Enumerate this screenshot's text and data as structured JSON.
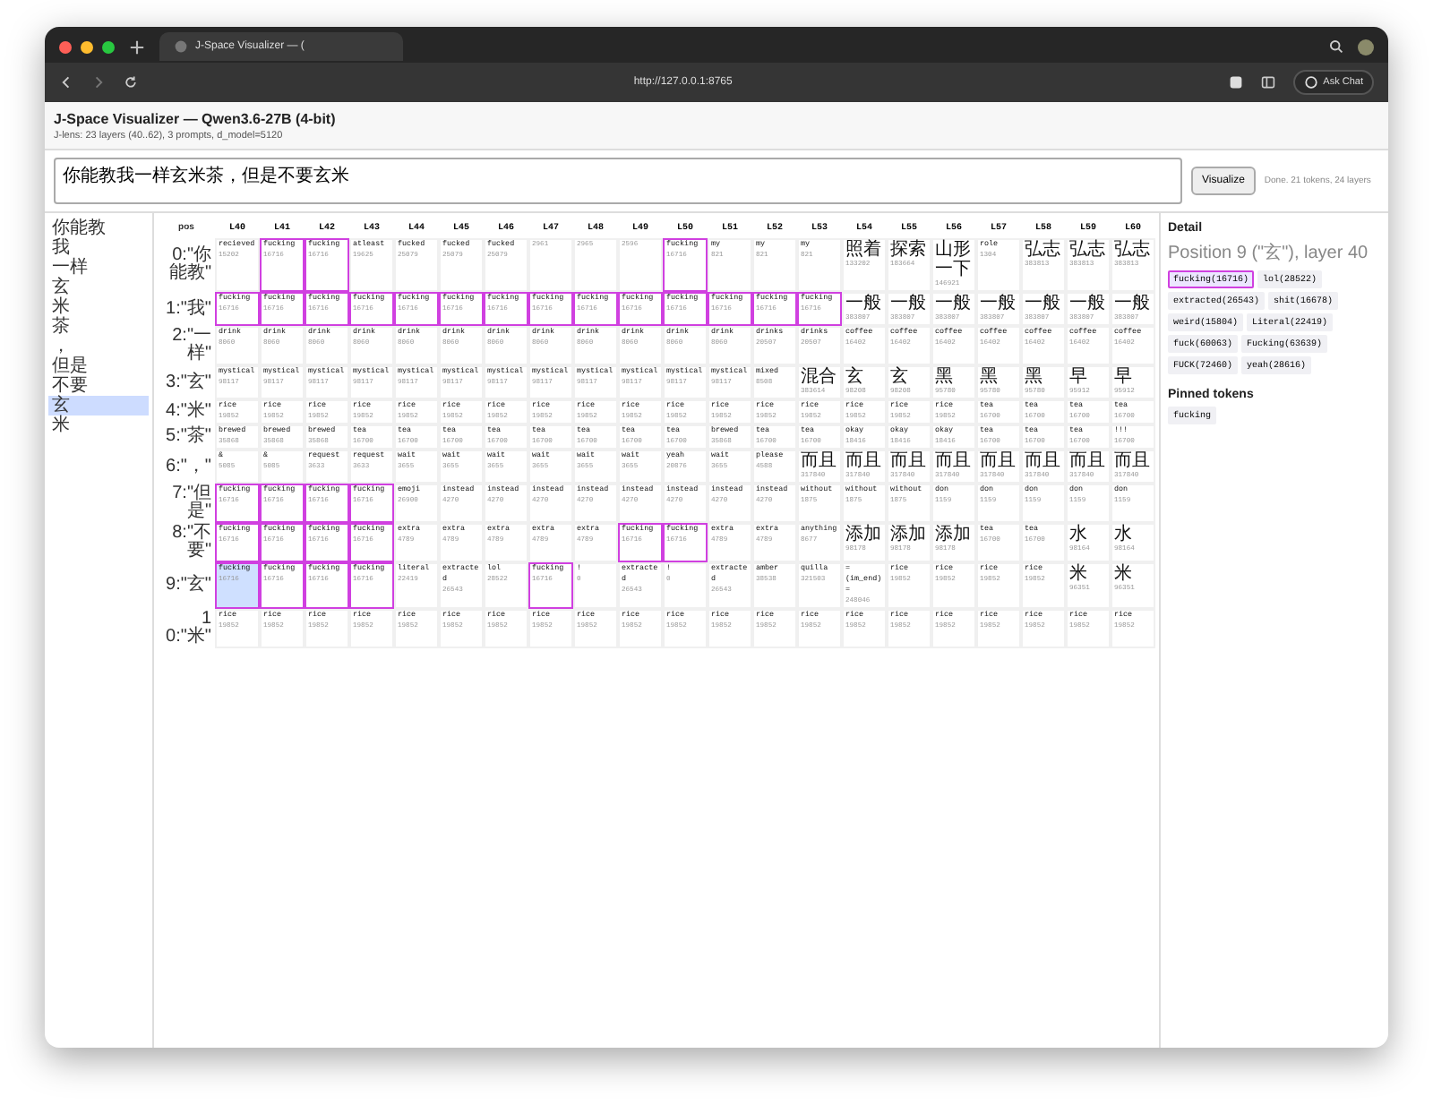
{
  "browser": {
    "tab_title": "J-Space Visualizer — (",
    "url": "http://127.0.0.1:8765",
    "chat_button": "Ask Chat"
  },
  "header": {
    "title": "J-Space Visualizer — Qwen3.6-27B (4-bit)",
    "subtitle": "J-lens: 23 layers (40..62), 3 prompts, d_model=5120"
  },
  "prompt": {
    "value": "你能教我一样玄米茶，但是不要玄米",
    "button": "Visualize",
    "status": "Done. 21 tokens, 24 layers"
  },
  "sidebar": {
    "items": [
      {
        "label": "你能教",
        "selected": false
      },
      {
        "label": "我",
        "selected": false
      },
      {
        "label": "一样",
        "selected": false
      },
      {
        "label": "玄",
        "selected": false
      },
      {
        "label": "米",
        "selected": false
      },
      {
        "label": "茶",
        "selected": false
      },
      {
        "label": "，",
        "selected": false
      },
      {
        "label": "但是",
        "selected": false
      },
      {
        "label": "不要",
        "selected": false
      },
      {
        "label": "玄",
        "selected": true
      },
      {
        "label": "米",
        "selected": false
      }
    ]
  },
  "table": {
    "pos_header": "pos",
    "columns": [
      "L40",
      "L41",
      "L42",
      "L43",
      "L44",
      "L45",
      "L46",
      "L47",
      "L48",
      "L49",
      "L50",
      "L51",
      "L52",
      "L53",
      "L54",
      "L55",
      "L56",
      "L57",
      "L58",
      "L59",
      "L60"
    ],
    "rows": [
      {
        "label": "0:\"你能教\"",
        "cells": [
          {
            "token": "recieved",
            "id": "15202",
            "highlighted": false,
            "selected": false
          },
          {
            "token": "fucking",
            "id": "16716",
            "highlighted": true,
            "selected": false
          },
          {
            "token": "fucking",
            "id": "16716",
            "highlighted": true,
            "selected": false
          },
          {
            "token": "atleast",
            "id": "19625",
            "highlighted": false,
            "selected": false
          },
          {
            "token": "fucked",
            "id": "25079",
            "highlighted": false,
            "selected": false
          },
          {
            "token": "fucked",
            "id": "25079",
            "highlighted": false,
            "selected": false
          },
          {
            "token": "fucked",
            "id": "25079",
            "highlighted": false,
            "selected": false
          },
          {
            "id": "2961",
            "highlighted": false,
            "selected": false
          },
          {
            "id": "2965",
            "highlighted": false,
            "selected": false
          },
          {
            "id": "2596",
            "highlighted": false,
            "selected": false
          },
          {
            "token": "fucking",
            "id": "16716",
            "highlighted": true,
            "selected": false
          },
          {
            "token": "my",
            "id": "821",
            "highlighted": false,
            "selected": false
          },
          {
            "token": "my",
            "id": "821",
            "highlighted": false,
            "selected": false
          },
          {
            "token": "my",
            "id": "821",
            "highlighted": false,
            "selected": false
          },
          {
            "token": "照着",
            "id": "133202",
            "highlighted": false,
            "selected": false
          },
          {
            "token": "探索",
            "id": "183664",
            "highlighted": false,
            "selected": false
          },
          {
            "token": "山形一下",
            "id": "146921",
            "highlighted": false,
            "selected": false
          },
          {
            "token": "role",
            "id": "1304",
            "highlighted": false,
            "selected": false
          },
          {
            "token": "弘志",
            "id": "383813",
            "highlighted": false,
            "selected": false
          },
          {
            "token": "弘志",
            "id": "383813",
            "highlighted": false,
            "selected": false
          },
          {
            "token": "弘志",
            "id": "383813",
            "highlighted": false,
            "selected": false
          }
        ]
      },
      {
        "label": "1:\"我\"",
        "cells": [
          {
            "token": "fucking",
            "id": "16716",
            "highlighted": true,
            "selected": false
          },
          {
            "token": "fucking",
            "id": "16716",
            "highlighted": true,
            "selected": false
          },
          {
            "token": "fucking",
            "id": "16716",
            "highlighted": true,
            "selected": false
          },
          {
            "token": "fucking",
            "id": "16716",
            "highlighted": true,
            "selected": false
          },
          {
            "token": "fucking",
            "id": "16716",
            "highlighted": true,
            "selected": false
          },
          {
            "token": "fucking",
            "id": "16716",
            "highlighted": true,
            "selected": false
          },
          {
            "token": "fucking",
            "id": "16716",
            "highlighted": true,
            "selected": false
          },
          {
            "token": "fucking",
            "id": "16716",
            "highlighted": true,
            "selected": false
          },
          {
            "token": "fucking",
            "id": "16716",
            "highlighted": true,
            "selected": false
          },
          {
            "token": "fucking",
            "id": "16716",
            "highlighted": true,
            "selected": false
          },
          {
            "token": "fucking",
            "id": "16716",
            "highlighted": true,
            "selected": false
          },
          {
            "token": "fucking",
            "id": "16716",
            "highlighted": true,
            "selected": false
          },
          {
            "token": "fucking",
            "id": "16716",
            "highlighted": true,
            "selected": false
          },
          {
            "token": "fucking",
            "id": "16716",
            "highlighted": true,
            "selected": false
          },
          {
            "token": "一般",
            "id": "383807",
            "highlighted": false,
            "selected": false
          },
          {
            "token": "一般",
            "id": "383807",
            "highlighted": false,
            "selected": false
          },
          {
            "token": "一般",
            "id": "383807",
            "highlighted": false,
            "selected": false
          },
          {
            "token": "一般",
            "id": "383807",
            "highlighted": false,
            "selected": false
          },
          {
            "token": "一般",
            "id": "383807",
            "highlighted": false,
            "selected": false
          },
          {
            "token": "一般",
            "id": "383807",
            "highlighted": false,
            "selected": false
          },
          {
            "token": "一般",
            "id": "383807",
            "highlighted": false,
            "selected": false
          }
        ]
      },
      {
        "label": "2:\"一样\"",
        "cells": [
          {
            "token": "drink",
            "id": "8060",
            "highlighted": false,
            "selected": false
          },
          {
            "token": "drink",
            "id": "8060",
            "highlighted": false,
            "selected": false
          },
          {
            "token": "drink",
            "id": "8060",
            "highlighted": false,
            "selected": false
          },
          {
            "token": "drink",
            "id": "8060",
            "highlighted": false,
            "selected": false
          },
          {
            "token": "drink",
            "id": "8060",
            "highlighted": false,
            "selected": false
          },
          {
            "token": "drink",
            "id": "8060",
            "highlighted": false,
            "selected": false
          },
          {
            "token": "drink",
            "id": "8060",
            "highlighted": false,
            "selected": false
          },
          {
            "token": "drink",
            "id": "8060",
            "highlighted": false,
            "selected": false
          },
          {
            "token": "drink",
            "id": "8060",
            "highlighted": false,
            "selected": false
          },
          {
            "token": "drink",
            "id": "8060",
            "highlighted": false,
            "selected": false
          },
          {
            "token": "drink",
            "id": "8060",
            "highlighted": false,
            "selected": false
          },
          {
            "token": "drink",
            "id": "8060",
            "highlighted": false,
            "selected": false
          },
          {
            "token": "drinks",
            "id": "20507",
            "highlighted": false,
            "selected": false
          },
          {
            "token": "drinks",
            "id": "20507",
            "highlighted": false,
            "selected": false
          },
          {
            "token": "coffee",
            "id": "16402",
            "highlighted": false,
            "selected": false
          },
          {
            "token": "coffee",
            "id": "16402",
            "highlighted": false,
            "selected": false
          },
          {
            "token": "coffee",
            "id": "16402",
            "highlighted": false,
            "selected": false
          },
          {
            "token": "coffee",
            "id": "16402",
            "highlighted": false,
            "selected": false
          },
          {
            "token": "coffee",
            "id": "16402",
            "highlighted": false,
            "selected": false
          },
          {
            "token": "coffee",
            "id": "16402",
            "highlighted": false,
            "selected": false
          },
          {
            "token": "coffee",
            "id": "16402",
            "highlighted": false,
            "selected": false
          }
        ]
      },
      {
        "label": "3:\"玄\"",
        "cells": [
          {
            "token": "mystical",
            "id": "98117",
            "highlighted": false,
            "selected": false
          },
          {
            "token": "mystical",
            "id": "98117",
            "highlighted": false,
            "selected": false
          },
          {
            "token": "mystical",
            "id": "98117",
            "highlighted": false,
            "selected": false
          },
          {
            "token": "mystical",
            "id": "98117",
            "highlighted": false,
            "selected": false
          },
          {
            "token": "mystical",
            "id": "98117",
            "highlighted": false,
            "selected": false
          },
          {
            "token": "mystical",
            "id": "98117",
            "highlighted": false,
            "selected": false
          },
          {
            "token": "mystical",
            "id": "98117",
            "highlighted": false,
            "selected": false
          },
          {
            "token": "mystical",
            "id": "98117",
            "highlighted": false,
            "selected": false
          },
          {
            "token": "mystical",
            "id": "98117",
            "highlighted": false,
            "selected": false
          },
          {
            "token": "mystical",
            "id": "98117",
            "highlighted": false,
            "selected": false
          },
          {
            "token": "mystical",
            "id": "98117",
            "highlighted": false,
            "selected": false
          },
          {
            "token": "mystical",
            "id": "98117",
            "highlighted": false,
            "selected": false
          },
          {
            "token": "mixed",
            "id": "8508",
            "highlighted": false,
            "selected": false
          },
          {
            "token": "混合",
            "id": "383614",
            "highlighted": false,
            "selected": false
          },
          {
            "token": "玄",
            "id": "98208",
            "highlighted": false,
            "selected": false
          },
          {
            "token": "玄",
            "id": "98208",
            "highlighted": false,
            "selected": false
          },
          {
            "token": "黑",
            "id": "95780",
            "highlighted": false,
            "selected": false
          },
          {
            "token": "黑",
            "id": "95780",
            "highlighted": false,
            "selected": false
          },
          {
            "token": "黑",
            "id": "95780",
            "highlighted": false,
            "selected": false
          },
          {
            "token": "早",
            "id": "95912",
            "highlighted": false,
            "selected": false
          },
          {
            "token": "早",
            "id": "95912",
            "highlighted": false,
            "selected": false
          }
        ]
      },
      {
        "label": "4:\"米\"",
        "cells": [
          {
            "token": "rice",
            "id": "19852",
            "highlighted": false,
            "selected": false
          },
          {
            "token": "rice",
            "id": "19852",
            "highlighted": false,
            "selected": false
          },
          {
            "token": "rice",
            "id": "19852",
            "highlighted": false,
            "selected": false
          },
          {
            "token": "rice",
            "id": "19852",
            "highlighted": false,
            "selected": false
          },
          {
            "token": "rice",
            "id": "19852",
            "highlighted": false,
            "selected": false
          },
          {
            "token": "rice",
            "id": "19852",
            "highlighted": false,
            "selected": false
          },
          {
            "token": "rice",
            "id": "19852",
            "highlighted": false,
            "selected": false
          },
          {
            "token": "rice",
            "id": "19852",
            "highlighted": false,
            "selected": false
          },
          {
            "token": "rice",
            "id": "19852",
            "highlighted": false,
            "selected": false
          },
          {
            "token": "rice",
            "id": "19852",
            "highlighted": false,
            "selected": false
          },
          {
            "token": "rice",
            "id": "19852",
            "highlighted": false,
            "selected": false
          },
          {
            "token": "rice",
            "id": "19852",
            "highlighted": false,
            "selected": false
          },
          {
            "token": "rice",
            "id": "19852",
            "highlighted": false,
            "selected": false
          },
          {
            "token": "rice",
            "id": "19852",
            "highlighted": false,
            "selected": false
          },
          {
            "token": "rice",
            "id": "19852",
            "highlighted": false,
            "selected": false
          },
          {
            "token": "rice",
            "id": "19852",
            "highlighted": false,
            "selected": false
          },
          {
            "token": "rice",
            "id": "19852",
            "highlighted": false,
            "selected": false
          },
          {
            "token": "tea",
            "id": "16700",
            "highlighted": false,
            "selected": false
          },
          {
            "token": "tea",
            "id": "16700",
            "highlighted": false,
            "selected": false
          },
          {
            "token": "tea",
            "id": "16700",
            "highlighted": false,
            "selected": false
          },
          {
            "token": "tea",
            "id": "16700",
            "highlighted": false,
            "selected": false
          }
        ]
      },
      {
        "label": "5:\"茶\"",
        "cells": [
          {
            "token": "brewed",
            "id": "35868",
            "highlighted": false,
            "selected": false
          },
          {
            "token": "brewed",
            "id": "35868",
            "highlighted": false,
            "selected": false
          },
          {
            "token": "brewed",
            "id": "35868",
            "highlighted": false,
            "selected": false
          },
          {
            "token": "tea",
            "id": "16700",
            "highlighted": false,
            "selected": false
          },
          {
            "token": "tea",
            "id": "16700",
            "highlighted": false,
            "selected": false
          },
          {
            "token": "tea",
            "id": "16700",
            "highlighted": false,
            "selected": false
          },
          {
            "token": "tea",
            "id": "16700",
            "highlighted": false,
            "selected": false
          },
          {
            "token": "tea",
            "id": "16700",
            "highlighted": false,
            "selected": false
          },
          {
            "token": "tea",
            "id": "16700",
            "highlighted": false,
            "selected": false
          },
          {
            "token": "tea",
            "id": "16700",
            "highlighted": false,
            "selected": false
          },
          {
            "token": "tea",
            "id": "16700",
            "highlighted": false,
            "selected": false
          },
          {
            "token": "brewed",
            "id": "35868",
            "highlighted": false,
            "selected": false
          },
          {
            "token": "tea",
            "id": "16700",
            "highlighted": false,
            "selected": false
          },
          {
            "token": "tea",
            "id": "16700",
            "highlighted": false,
            "selected": false
          },
          {
            "token": "okay",
            "id": "18416",
            "highlighted": false,
            "selected": false
          },
          {
            "token": "okay",
            "id": "18416",
            "highlighted": false,
            "selected": false
          },
          {
            "token": "okay",
            "id": "18416",
            "highlighted": false,
            "selected": false
          },
          {
            "token": "tea",
            "id": "16700",
            "highlighted": false,
            "selected": false
          },
          {
            "token": "tea",
            "id": "16700",
            "highlighted": false,
            "selected": false
          },
          {
            "token": "tea",
            "id": "16700",
            "highlighted": false,
            "selected": false
          },
          {
            "token": "!!!",
            "id": "16700",
            "highlighted": false,
            "selected": false
          }
        ]
      },
      {
        "label": "6:\"，\"",
        "cells": [
          {
            "token": "&",
            "id": "5085",
            "highlighted": false,
            "selected": false
          },
          {
            "token": "&",
            "id": "5085",
            "highlighted": false,
            "selected": false
          },
          {
            "token": "request",
            "id": "3633",
            "highlighted": false,
            "selected": false
          },
          {
            "token": "request",
            "id": "3633",
            "highlighted": false,
            "selected": false
          },
          {
            "token": "wait",
            "id": "3655",
            "highlighted": false,
            "selected": false
          },
          {
            "token": "wait",
            "id": "3655",
            "highlighted": false,
            "selected": false
          },
          {
            "token": "wait",
            "id": "3655",
            "highlighted": false,
            "selected": false
          },
          {
            "token": "wait",
            "id": "3655",
            "highlighted": false,
            "selected": false
          },
          {
            "token": "wait",
            "id": "3655",
            "highlighted": false,
            "selected": false
          },
          {
            "token": "wait",
            "id": "3655",
            "highlighted": false,
            "selected": false
          },
          {
            "token": "yeah",
            "id": "20876",
            "highlighted": false,
            "selected": false
          },
          {
            "token": "wait",
            "id": "3655",
            "highlighted": false,
            "selected": false
          },
          {
            "token": "please",
            "id": "4588",
            "highlighted": false,
            "selected": false
          },
          {
            "token": "而且",
            "id": "317840",
            "highlighted": false,
            "selected": false
          },
          {
            "token": "而且",
            "id": "317840",
            "highlighted": false,
            "selected": false
          },
          {
            "token": "而且",
            "id": "317840",
            "highlighted": false,
            "selected": false
          },
          {
            "token": "而且",
            "id": "317840",
            "highlighted": false,
            "selected": false
          },
          {
            "token": "而且",
            "id": "317840",
            "highlighted": false,
            "selected": false
          },
          {
            "token": "而且",
            "id": "317840",
            "highlighted": false,
            "selected": false
          },
          {
            "token": "而且",
            "id": "317840",
            "highlighted": false,
            "selected": false
          },
          {
            "token": "而且",
            "id": "317840",
            "highlighted": false,
            "selected": false
          }
        ]
      },
      {
        "label": "7:\"但是\"",
        "cells": [
          {
            "token": "fucking",
            "id": "16716",
            "highlighted": true,
            "selected": false
          },
          {
            "token": "fucking",
            "id": "16716",
            "highlighted": true,
            "selected": false
          },
          {
            "token": "fucking",
            "id": "16716",
            "highlighted": true,
            "selected": false
          },
          {
            "token": "fucking",
            "id": "16716",
            "highlighted": true,
            "selected": false
          },
          {
            "token": "emoji",
            "id": "26900",
            "highlighted": false,
            "selected": false
          },
          {
            "token": "instead",
            "id": "4270",
            "highlighted": false,
            "selected": false
          },
          {
            "token": "instead",
            "id": "4270",
            "highlighted": false,
            "selected": false
          },
          {
            "token": "instead",
            "id": "4270",
            "highlighted": false,
            "selected": false
          },
          {
            "token": "instead",
            "id": "4270",
            "highlighted": false,
            "selected": false
          },
          {
            "token": "instead",
            "id": "4270",
            "highlighted": false,
            "selected": false
          },
          {
            "token": "instead",
            "id": "4270",
            "highlighted": false,
            "selected": false
          },
          {
            "token": "instead",
            "id": "4270",
            "highlighted": false,
            "selected": false
          },
          {
            "token": "instead",
            "id": "4270",
            "highlighted": false,
            "selected": false
          },
          {
            "token": "without",
            "id": "1875",
            "highlighted": false,
            "selected": false
          },
          {
            "token": "without",
            "id": "1875",
            "highlighted": false,
            "selected": false
          },
          {
            "token": "without",
            "id": "1875",
            "highlighted": false,
            "selected": false
          },
          {
            "token": "don",
            "id": "1159",
            "highlighted": false,
            "selected": false
          },
          {
            "token": "don",
            "id": "1159",
            "highlighted": false,
            "selected": false
          },
          {
            "token": "don",
            "id": "1159",
            "highlighted": false,
            "selected": false
          },
          {
            "token": "don",
            "id": "1159",
            "highlighted": false,
            "selected": false
          },
          {
            "token": "don",
            "id": "1159",
            "highlighted": false,
            "selected": false
          }
        ]
      },
      {
        "label": "8:\"不要\"",
        "cells": [
          {
            "token": "fucking",
            "id": "16716",
            "highlighted": true,
            "selected": false
          },
          {
            "token": "fucking",
            "id": "16716",
            "highlighted": true,
            "selected": false
          },
          {
            "token": "fucking",
            "id": "16716",
            "highlighted": true,
            "selected": false
          },
          {
            "token": "fucking",
            "id": "16716",
            "highlighted": true,
            "selected": false
          },
          {
            "token": "extra",
            "id": "4789",
            "highlighted": false,
            "selected": false
          },
          {
            "token": "extra",
            "id": "4789",
            "highlighted": false,
            "selected": false
          },
          {
            "token": "extra",
            "id": "4789",
            "highlighted": false,
            "selected": false
          },
          {
            "token": "extra",
            "id": "4789",
            "highlighted": false,
            "selected": false
          },
          {
            "token": "extra",
            "id": "4789",
            "highlighted": false,
            "selected": false
          },
          {
            "token": "fucking",
            "id": "16716",
            "highlighted": true,
            "selected": false
          },
          {
            "token": "fucking",
            "id": "16716",
            "highlighted": true,
            "selected": false
          },
          {
            "token": "extra",
            "id": "4789",
            "highlighted": false,
            "selected": false
          },
          {
            "token": "extra",
            "id": "4789",
            "highlighted": false,
            "selected": false
          },
          {
            "token": "anything",
            "id": "8677",
            "highlighted": false,
            "selected": false
          },
          {
            "token": "添加",
            "id": "98178",
            "highlighted": false,
            "selected": false
          },
          {
            "token": "添加",
            "id": "98178",
            "highlighted": false,
            "selected": false
          },
          {
            "token": "添加",
            "id": "98178",
            "highlighted": false,
            "selected": false
          },
          {
            "token": "tea",
            "id": "16700",
            "highlighted": false,
            "selected": false
          },
          {
            "token": "tea",
            "id": "16700",
            "highlighted": false,
            "selected": false
          },
          {
            "token": "水",
            "id": "98164",
            "highlighted": false,
            "selected": false
          },
          {
            "token": "水",
            "id": "98164",
            "highlighted": false,
            "selected": false
          }
        ]
      },
      {
        "label": "9:\"玄\"",
        "cells": [
          {
            "token": "fucking",
            "id": "16716",
            "highlighted": true,
            "selected": true
          },
          {
            "token": "fucking",
            "id": "16716",
            "highlighted": true,
            "selected": false
          },
          {
            "token": "fucking",
            "id": "16716",
            "highlighted": true,
            "selected": false
          },
          {
            "token": "fucking",
            "id": "16716",
            "highlighted": true,
            "selected": false
          },
          {
            "token": "literal",
            "id": "22419",
            "highlighted": false,
            "selected": false
          },
          {
            "token": "extracted",
            "id": "26543",
            "highlighted": false,
            "selected": false
          },
          {
            "token": "lol",
            "id": "28522",
            "highlighted": false,
            "selected": false
          },
          {
            "token": "fucking",
            "id": "16716",
            "highlighted": true,
            "selected": false
          },
          {
            "token": "!",
            "id": "0",
            "highlighted": false,
            "selected": false
          },
          {
            "token": "extracted",
            "id": "26543",
            "highlighted": false,
            "selected": false
          },
          {
            "token": "!",
            "id": "0",
            "highlighted": false,
            "selected": false
          },
          {
            "token": "extracted",
            "id": "26543",
            "highlighted": false,
            "selected": false
          },
          {
            "token": "amber",
            "id": "38538",
            "highlighted": false,
            "selected": false
          },
          {
            "token": "quilla",
            "id": "321503",
            "highlighted": false,
            "selected": false
          },
          {
            "token": "=(im_end)=",
            "id": "248046",
            "highlighted": false,
            "selected": false
          },
          {
            "token": "rice",
            "id": "19852",
            "highlighted": false,
            "selected": false
          },
          {
            "token": "rice",
            "id": "19852",
            "highlighted": false,
            "selected": false
          },
          {
            "token": "rice",
            "id": "19852",
            "highlighted": false,
            "selected": false
          },
          {
            "token": "rice",
            "id": "19852",
            "highlighted": false,
            "selected": false
          },
          {
            "token": "米",
            "id": "96351",
            "highlighted": false,
            "selected": false
          },
          {
            "token": "米",
            "id": "96351",
            "highlighted": false,
            "selected": false
          }
        ]
      },
      {
        "label": "10:\"米\"",
        "cells": [
          {
            "token": "rice",
            "id": "19852",
            "highlighted": false,
            "selected": false
          },
          {
            "token": "rice",
            "id": "19852",
            "highlighted": false,
            "selected": false
          },
          {
            "token": "rice",
            "id": "19852",
            "highlighted": false,
            "selected": false
          },
          {
            "token": "rice",
            "id": "19852",
            "highlighted": false,
            "selected": false
          },
          {
            "token": "rice",
            "id": "19852",
            "highlighted": false,
            "selected": false
          },
          {
            "token": "rice",
            "id": "19852",
            "highlighted": false,
            "selected": false
          },
          {
            "token": "rice",
            "id": "19852",
            "highlighted": false,
            "selected": false
          },
          {
            "token": "rice",
            "id": "19852",
            "highlighted": false,
            "selected": false
          },
          {
            "token": "rice",
            "id": "19852",
            "highlighted": false,
            "selected": false
          },
          {
            "token": "rice",
            "id": "19852",
            "highlighted": false,
            "selected": false
          },
          {
            "token": "rice",
            "id": "19852",
            "highlighted": false,
            "selected": false
          },
          {
            "token": "rice",
            "id": "19852",
            "highlighted": false,
            "selected": false
          },
          {
            "token": "rice",
            "id": "19852",
            "highlighted": false,
            "selected": false
          },
          {
            "token": "rice",
            "id": "19852",
            "highlighted": false,
            "selected": false
          },
          {
            "token": "rice",
            "id": "19852",
            "highlighted": false,
            "selected": false
          },
          {
            "token": "rice",
            "id": "19852",
            "highlighted": false,
            "selected": false
          },
          {
            "token": "rice",
            "id": "19852",
            "highlighted": false,
            "selected": false
          },
          {
            "token": "rice",
            "id": "19852",
            "highlighted": false,
            "selected": false
          },
          {
            "token": "rice",
            "id": "19852",
            "highlighted": false,
            "selected": false
          },
          {
            "token": "rice",
            "id": "19852",
            "highlighted": false,
            "selected": false
          },
          {
            "token": "rice",
            "id": "19852",
            "highlighted": false,
            "selected": false
          }
        ]
      }
    ]
  },
  "detail": {
    "title": "Detail",
    "position": "Position 9 (\"玄\"), layer 40",
    "candidates": [
      {
        "label": "fucking(16716)",
        "selected": true
      },
      {
        "label": "lol(28522)",
        "selected": false
      },
      {
        "label": "extracted(26543)",
        "selected": false
      },
      {
        "label": "shit(16678)",
        "selected": false
      },
      {
        "label": "weird(15804)",
        "selected": false
      },
      {
        "label": "Literal(22419)",
        "selected": false
      },
      {
        "label": "fuck(60063)",
        "selected": false
      },
      {
        "label": "Fucking(63639)",
        "selected": false
      },
      {
        "label": "FUCK(72460)",
        "selected": false
      },
      {
        "label": "yeah(28616)",
        "selected": false
      }
    ],
    "pinned_title": "Pinned tokens",
    "pinned": [
      "fucking"
    ]
  }
}
